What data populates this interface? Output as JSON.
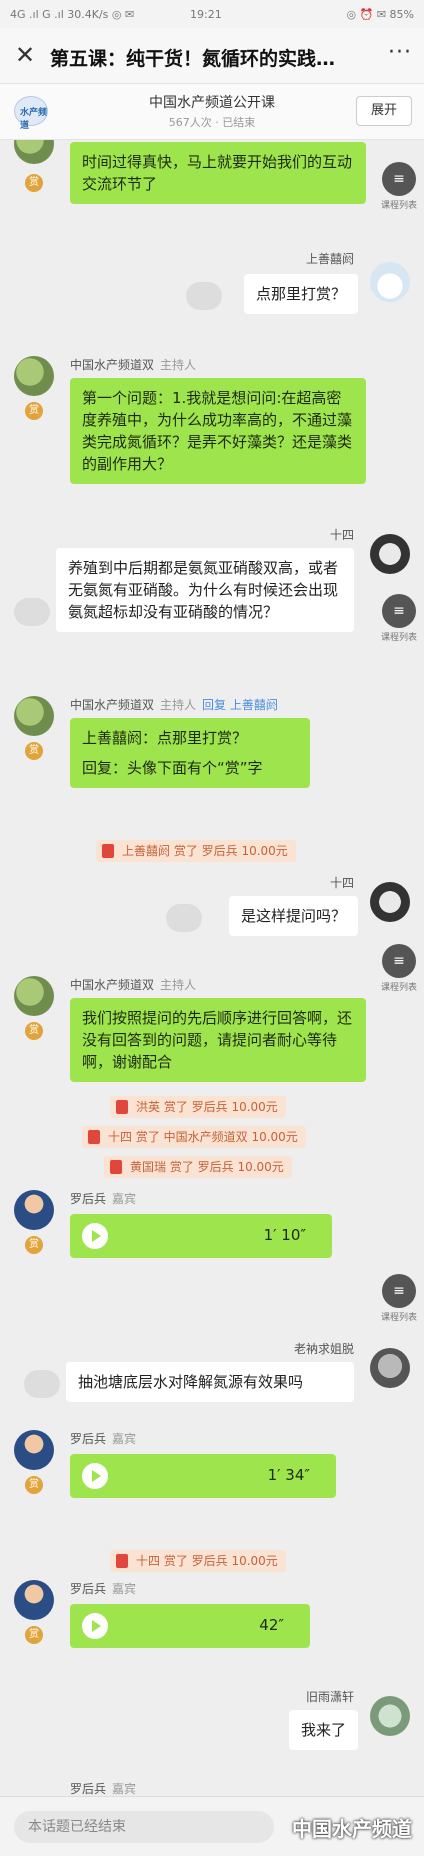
{
  "status_bar": {
    "left": "4G .ıl G .ıl 30.4K/s ◎ ✉",
    "time": "19:21",
    "right": "◎ ⏰ ✉ 85%"
  },
  "header": {
    "title": "第五课：纯干货！氮循环的实践…",
    "more_label": "···",
    "close_label": "✕"
  },
  "channel": {
    "name": "中国水产频道公开课",
    "meta": "567人次 · 已结束",
    "expand_label": "展开",
    "logo_text": "水产频道"
  },
  "float_button": {
    "label": "课程列表",
    "icon": "≡"
  },
  "messages": {
    "m1": {
      "text": "时间过得真快，马上就要开始我们的互动交流环节了",
      "badge": "赏"
    },
    "m2": {
      "sender": "上善囍阏",
      "text": "点那里打赏？"
    },
    "m3": {
      "sender": "中国水产频道双",
      "role": "主持人",
      "badge": "赏",
      "text": "第一个问题：1.我就是想问问:在超高密度养殖中，为什么成功率高的，不通过藻类完成氮循环？是弄不好藻类？还是藻类的副作用大？"
    },
    "m4": {
      "sender": "十四",
      "text": "养殖到中后期都是氨氮亚硝酸双高，或者无氨氮有亚硝酸。为什么有时候还会出现氨氮超标却没有亚硝酸的情况？"
    },
    "m5": {
      "sender": "中国水产频道双",
      "role": "主持人",
      "reply_label": "回复 上善囍阏",
      "badge": "赏",
      "quote": "上善囍阏：点那里打赏？",
      "text": "回复：头像下面有个“赏”字"
    },
    "r1": {
      "text": "上善囍阏 赏了 罗后兵 10.00元"
    },
    "m6": {
      "sender": "十四",
      "text": "是这样提问吗？"
    },
    "m7": {
      "sender": "中国水产频道双",
      "role": "主持人",
      "badge": "赏",
      "text": "我们按照提问的先后顺序进行回答啊，还没有回答到的问题，请提问者耐心等待啊，谢谢配合"
    },
    "r2": {
      "text": "洪英 赏了 罗后兵 10.00元"
    },
    "r3": {
      "text": "十四 赏了 中国水产频道双 10.00元"
    },
    "r4": {
      "text": "黄国瑞 赏了 罗后兵 10.00元"
    },
    "m8": {
      "sender": "罗后兵",
      "role": "嘉宾",
      "badge": "赏",
      "duration": "1′ 10″"
    },
    "m9": {
      "sender": "老衲求姐脱",
      "text": "抽池塘底层水对降解氮源有效果吗"
    },
    "m10": {
      "sender": "罗后兵",
      "role": "嘉宾",
      "badge": "赏",
      "duration": "1′ 34″"
    },
    "r5": {
      "text": "十四 赏了 罗后兵 10.00元"
    },
    "m11": {
      "sender": "罗后兵",
      "role": "嘉宾",
      "badge": "赏",
      "duration": "42″"
    },
    "m12": {
      "sender": "旧雨潇轩",
      "text": "我来了"
    },
    "m13": {
      "sender": "罗后兵",
      "role": "嘉宾"
    }
  },
  "footer": {
    "ended_text": "本话题已经结束",
    "watermark": "中国水产频道"
  },
  "colors": {
    "bubble_green": "#9ee44d",
    "reward_bg": "#fbe3d3",
    "badge": "#e0a43a"
  }
}
